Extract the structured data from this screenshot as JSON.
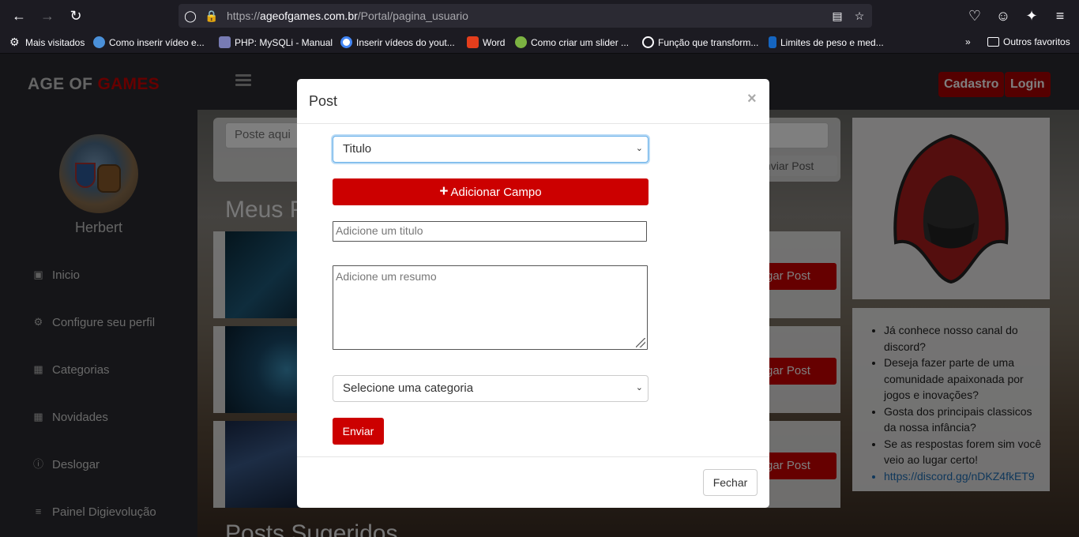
{
  "browser": {
    "url_prefix": "https://",
    "url_domain": "ageofgames.com.br",
    "url_path": "/Portal/pagina_usuario",
    "icons": {
      "back": "back-arrow-icon",
      "forward": "forward-arrow-icon",
      "reload": "reload-icon",
      "shield": "tracking-shield-icon",
      "lock": "lock-icon",
      "reader": "reader-view-icon",
      "star": "bookmark-star-icon",
      "pocket": "pocket-icon",
      "account": "account-icon",
      "extensions": "extensions-icon",
      "menu": "menu-icon"
    },
    "bookmarks": [
      {
        "label": "Mais visitados",
        "icon": "gear-icon"
      },
      {
        "label": "Como inserir vídeo e...",
        "icon": "globe-icon"
      },
      {
        "label": "PHP: MySQLi - Manual",
        "icon": "php-icon"
      },
      {
        "label": "Inserir vídeos do yout...",
        "icon": "google-icon"
      },
      {
        "label": "Word",
        "icon": "office-icon"
      },
      {
        "label": "Como criar um slider ...",
        "icon": "site-icon"
      },
      {
        "label": "Função que transform...",
        "icon": "globe-icon"
      },
      {
        "label": "Limites de peso e med...",
        "icon": "site-icon"
      }
    ],
    "other_bookmarks": "Outros favoritos"
  },
  "header": {
    "logo_part1": "AGE OF ",
    "logo_part2": "GAMES",
    "cadastro": "Cadastro",
    "login": "Login"
  },
  "sidebar": {
    "username": "Herbert",
    "items": [
      {
        "label": "Inicio",
        "icon": "monitor-icon"
      },
      {
        "label": "Configure seu perfil",
        "icon": "cogs-icon"
      },
      {
        "label": "Categorias",
        "icon": "table-icon"
      },
      {
        "label": "Novidades",
        "icon": "grid-icon"
      },
      {
        "label": "Deslogar",
        "icon": "info-icon"
      },
      {
        "label": "Painel Digievolução",
        "icon": "sliders-icon"
      }
    ]
  },
  "main": {
    "post_placeholder": "Poste aqui",
    "post_button": "nviar Post",
    "section_title": "Meus P",
    "post_button_label": "gar Post",
    "section_title2": "Posts Sugeridos",
    "info_list": [
      "Já conhece nosso canal do discord?",
      "Deseja fazer parte de uma comunidade apaixonada por jogos e inovações?",
      "Gosta dos principais classicos da nossa infância?",
      "Se as respostas forem sim você veio ao lugar certo!",
      "https://discord.gg/nDKZ4fkET9"
    ]
  },
  "modal": {
    "title": "Post",
    "close": "×",
    "field_type_selected": "Titulo",
    "add_field_button": "Adicionar Campo",
    "title_placeholder": "Adicione um titulo",
    "summary_placeholder": "Adicione um resumo",
    "category_selected": "Selecione uma categoria",
    "submit_button": "Enviar",
    "close_button": "Fechar"
  },
  "colors": {
    "brand_red": "#cc0000",
    "focus_blue": "#66afe9",
    "link_blue": "#1f6fb6"
  }
}
